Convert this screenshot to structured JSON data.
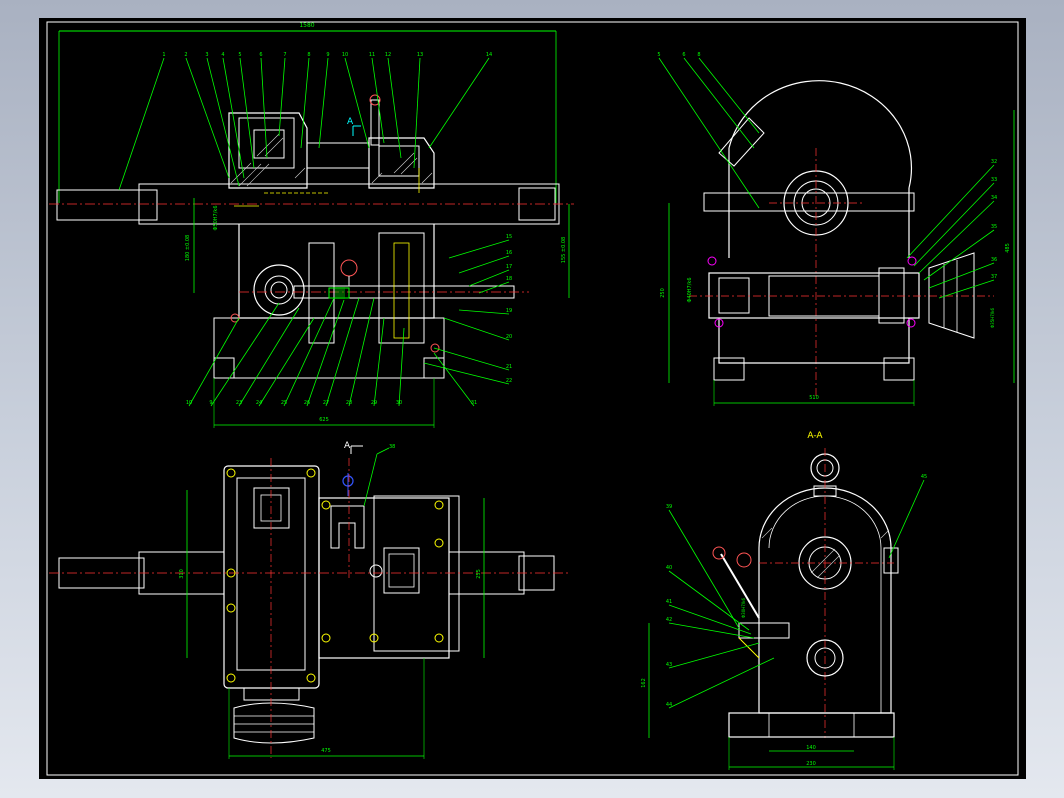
{
  "drawing": {
    "section_label": "A-A",
    "view_arrow_label": "A",
    "top_left_view": {
      "balloons": [
        "1",
        "2",
        "3",
        "4",
        "5",
        "6",
        "7",
        "8",
        "9",
        "10",
        "11",
        "12",
        "13",
        "14"
      ],
      "right_balloons": [
        "15",
        "16",
        "17",
        "18",
        "19",
        "20",
        "21",
        "22"
      ],
      "bottom_balloons": [
        "10",
        "9",
        "23",
        "24",
        "25",
        "26",
        "27",
        "28",
        "29",
        "30",
        "31"
      ],
      "dim_overall": "1580",
      "dim_bottom": "625",
      "dim_left": "180 ±0.08",
      "dim_right": "155 ±0.08",
      "dim_bore": "Φ50H7/k6"
    },
    "top_right_view": {
      "balloons": [
        "5",
        "6",
        "8"
      ],
      "right_balloons": [
        "32",
        "33",
        "34",
        "35",
        "36",
        "37"
      ],
      "dim_height": "485",
      "dim_left": "250",
      "dim_bottom": "510",
      "dim_bore": "Φ40H7/k6",
      "dim_bore2": "Φ35H7/k6"
    },
    "bottom_left_view": {
      "dim_left": "310",
      "dim_right": "255",
      "dim_bottom": "475",
      "balloon": "38"
    },
    "bottom_right_view": {
      "balloons": [
        "39",
        "40",
        "41",
        "42",
        "43",
        "44"
      ],
      "balloon_right": "45",
      "dim_left": "162",
      "dim_inner": "140",
      "dim_outer": "230",
      "dim_bore": "Φ30H7/k6"
    }
  },
  "colors": {
    "outline": "#ffffff",
    "leader": "#00ff00",
    "hidden": "#ffff00",
    "centerline": "#ff3333",
    "accent": "#00ffff",
    "magenta": "#ff00ff",
    "blue": "#3355ff"
  }
}
